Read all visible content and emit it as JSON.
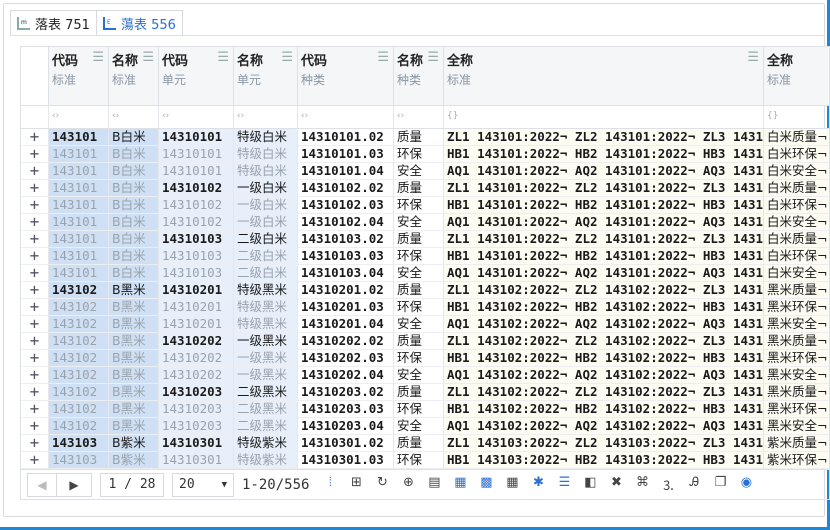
{
  "tabs": [
    {
      "label": "落表 751",
      "icon": "table-icon",
      "active": false
    },
    {
      "label": "蕩表 556",
      "icon": "table-edit-icon",
      "active": true
    }
  ],
  "columns": [
    {
      "title": "代码",
      "sub": "标准",
      "filter": "‹›"
    },
    {
      "title": "名称",
      "sub": "标准",
      "filter": "‹›"
    },
    {
      "title": "代码",
      "sub": "单元",
      "filter": "‹›"
    },
    {
      "title": "名称",
      "sub": "单元",
      "filter": "‹›"
    },
    {
      "title": "代码",
      "sub": "种类",
      "filter": "‹›"
    },
    {
      "title": "名称",
      "sub": "种类",
      "filter": "‹›"
    },
    {
      "title": "全称",
      "sub": "标准",
      "filter": "{}"
    },
    {
      "title": "全称",
      "sub": "标准",
      "filter": "{}"
    }
  ],
  "rows": [
    [
      "143101",
      "B白米",
      "14310101",
      "特级白米",
      "14310101.02",
      "质量",
      "ZL1 143101:2022¬ ZL2 143101:2022¬ ZL3 143101",
      "白米质量¬"
    ],
    [
      "143101",
      "B白米",
      "14310101",
      "特级白米",
      "14310101.03",
      "环保",
      "HB1 143101:2022¬ HB2 143101:2022¬ HB3 143101",
      "白米环保¬"
    ],
    [
      "143101",
      "B白米",
      "14310101",
      "特级白米",
      "14310101.04",
      "安全",
      "AQ1 143101:2022¬ AQ2 143101:2022¬ AQ3 143101",
      "白米安全¬"
    ],
    [
      "143101",
      "B白米",
      "14310102",
      "一级白米",
      "14310102.02",
      "质量",
      "ZL1 143101:2022¬ ZL2 143101:2022¬ ZL3 143101",
      "白米质量¬"
    ],
    [
      "143101",
      "B白米",
      "14310102",
      "一级白米",
      "14310102.03",
      "环保",
      "HB1 143101:2022¬ HB2 143101:2022¬ HB3 143101",
      "白米环保¬"
    ],
    [
      "143101",
      "B白米",
      "14310102",
      "一级白米",
      "14310102.04",
      "安全",
      "AQ1 143101:2022¬ AQ2 143101:2022¬ AQ3 143101",
      "白米安全¬"
    ],
    [
      "143101",
      "B白米",
      "14310103",
      "二级白米",
      "14310103.02",
      "质量",
      "ZL1 143101:2022¬ ZL2 143101:2022¬ ZL3 143101",
      "白米质量¬"
    ],
    [
      "143101",
      "B白米",
      "14310103",
      "二级白米",
      "14310103.03",
      "环保",
      "HB1 143101:2022¬ HB2 143101:2022¬ HB3 143101",
      "白米环保¬"
    ],
    [
      "143101",
      "B白米",
      "14310103",
      "二级白米",
      "14310103.04",
      "安全",
      "AQ1 143101:2022¬ AQ2 143101:2022¬ AQ3 143101",
      "白米安全¬"
    ],
    [
      "143102",
      "B黑米",
      "14310201",
      "特级黑米",
      "14310201.02",
      "质量",
      "ZL1 143102:2022¬ ZL2 143102:2022¬ ZL3 143102",
      "黑米质量¬"
    ],
    [
      "143102",
      "B黑米",
      "14310201",
      "特级黑米",
      "14310201.03",
      "环保",
      "HB1 143102:2022¬ HB2 143102:2022¬ HB3 143102",
      "黑米环保¬"
    ],
    [
      "143102",
      "B黑米",
      "14310201",
      "特级黑米",
      "14310201.04",
      "安全",
      "AQ1 143102:2022¬ AQ2 143102:2022¬ AQ3 143102",
      "黑米安全¬"
    ],
    [
      "143102",
      "B黑米",
      "14310202",
      "一级黑米",
      "14310202.02",
      "质量",
      "ZL1 143102:2022¬ ZL2 143102:2022¬ ZL3 143102",
      "黑米质量¬"
    ],
    [
      "143102",
      "B黑米",
      "14310202",
      "一级黑米",
      "14310202.03",
      "环保",
      "HB1 143102:2022¬ HB2 143102:2022¬ HB3 143102",
      "黑米环保¬"
    ],
    [
      "143102",
      "B黑米",
      "14310202",
      "一级黑米",
      "14310202.04",
      "安全",
      "AQ1 143102:2022¬ AQ2 143102:2022¬ AQ3 143102",
      "黑米安全¬"
    ],
    [
      "143102",
      "B黑米",
      "14310203",
      "二级黑米",
      "14310203.02",
      "质量",
      "ZL1 143102:2022¬ ZL2 143102:2022¬ ZL3 143102",
      "黑米质量¬"
    ],
    [
      "143102",
      "B黑米",
      "14310203",
      "二级黑米",
      "14310203.03",
      "环保",
      "HB1 143102:2022¬ HB2 143102:2022¬ HB3 143102",
      "黑米环保¬"
    ],
    [
      "143102",
      "B黑米",
      "14310203",
      "二级黑米",
      "14310203.04",
      "安全",
      "AQ1 143102:2022¬ AQ2 143102:2022¬ AQ3 143102",
      "黑米安全¬"
    ],
    [
      "143103",
      "B紫米",
      "14310301",
      "特级紫米",
      "14310301.02",
      "质量",
      "ZL1 143103:2022¬ ZL2 143103:2022¬ ZL3 143103",
      "紫米质量¬"
    ],
    [
      "143103",
      "B紫米",
      "14310301",
      "特级紫米",
      "14310301.03",
      "环保",
      "HB1 143103:2022¬ HB2 143103:2022¬ HB3 143103",
      "紫米环保¬"
    ]
  ],
  "row_action_icon": "+",
  "footer": {
    "page": "1 / 28",
    "page_size": "20",
    "range": "1-20/556",
    "tools": [
      {
        "name": "columns-icon",
        "glyph": "⦙",
        "blue": true
      },
      {
        "name": "insert-row-icon",
        "glyph": "⊞",
        "blue": false
      },
      {
        "name": "refresh-icon",
        "glyph": "↻",
        "blue": false
      },
      {
        "name": "sync-icon",
        "glyph": "⊕",
        "blue": false
      },
      {
        "name": "layout-icon",
        "glyph": "▤",
        "blue": false
      },
      {
        "name": "grid-icon",
        "glyph": "▦",
        "blue": true
      },
      {
        "name": "grid-select-icon",
        "glyph": "▩",
        "blue": true
      },
      {
        "name": "grid-dark-icon",
        "glyph": "▦",
        "blue": false
      },
      {
        "name": "asterisk-icon",
        "glyph": "✱",
        "blue": true
      },
      {
        "name": "list-icon",
        "glyph": "☰",
        "blue": true
      },
      {
        "name": "excel-icon",
        "glyph": "◧",
        "blue": false
      },
      {
        "name": "delete-icon",
        "glyph": "✖",
        "blue": false
      },
      {
        "name": "expand-icon",
        "glyph": "⌘",
        "blue": false
      },
      {
        "name": "numbering-icon",
        "glyph": "⒊",
        "blue": false
      },
      {
        "name": "text-format-icon",
        "glyph": "Ꭿ",
        "blue": false
      },
      {
        "name": "copy-icon",
        "glyph": "❐",
        "blue": false
      },
      {
        "name": "eye-icon",
        "glyph": "◉",
        "blue": true
      }
    ]
  },
  "colors": {
    "accent": "#2a6fd6",
    "selection": "#cfe0f4",
    "selection_light": "#e7f0fa",
    "cream": "#fdfcf3"
  }
}
